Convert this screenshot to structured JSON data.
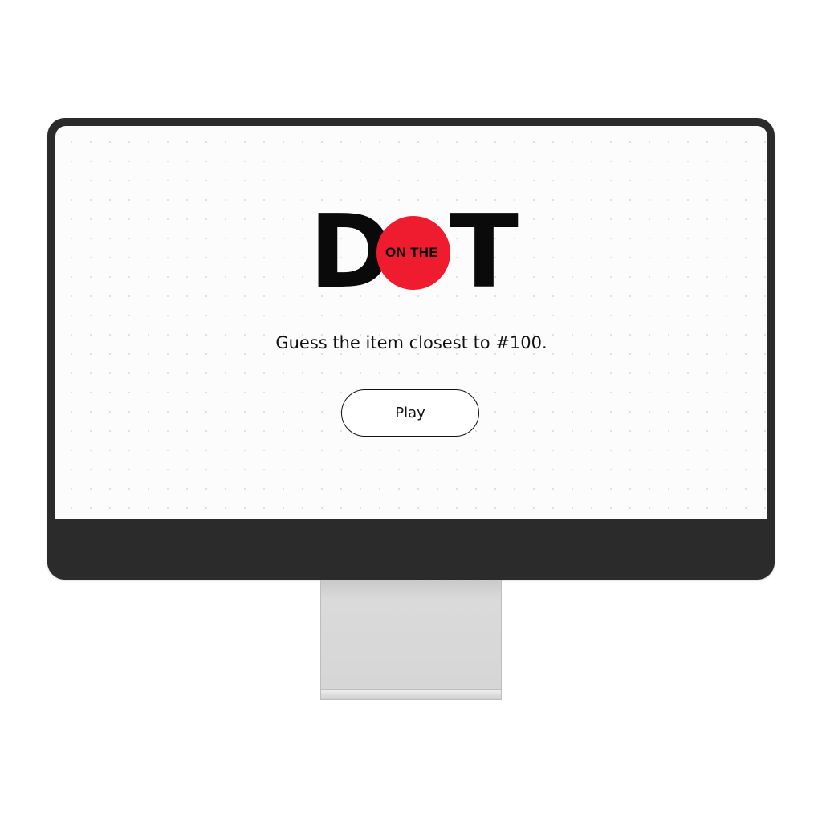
{
  "logo": {
    "letter_left": "D",
    "dot_text": "ON THE",
    "letter_right": "T",
    "dot_color": "#ee1c2e"
  },
  "prompt": "Guess the item closest to #100.",
  "play_button": {
    "label": "Play"
  },
  "colors": {
    "bezel": "#2b2b2b",
    "screen_background": "#fcfcfc",
    "accent_red": "#ee1c2e"
  }
}
